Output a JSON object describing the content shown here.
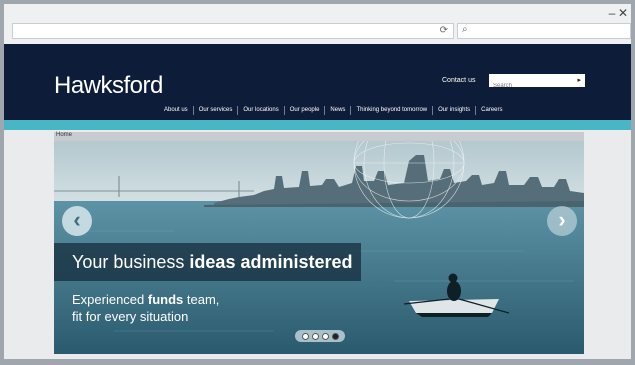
{
  "browser": {
    "window_controls": {
      "minimize": "–",
      "close": "✕"
    },
    "address": {
      "value": "",
      "refresh_icon": "⟳"
    },
    "search": {
      "value": "",
      "icon": "⌕"
    }
  },
  "site": {
    "logo": "Hawksford",
    "contact_label": "Contact us",
    "search_placeholder": "Search",
    "search_go": "▸",
    "nav": [
      "About us",
      "Our services",
      "Our locations",
      "Our people",
      "News",
      "Thinking beyond tomorrow",
      "Our insights",
      "Careers"
    ],
    "breadcrumb": "Home",
    "hero": {
      "headline_light": "Your business ",
      "headline_bold": "ideas administered",
      "sub_line1_light": "Experienced ",
      "sub_line1_bold": "funds",
      "sub_line1_rest": " team,",
      "sub_line2": "fit for every situation",
      "prev_arrow": "‹",
      "next_arrow": "›",
      "slides": 4,
      "active_slide": 4
    },
    "colors": {
      "header": "#0d1c38",
      "band": "#49b6c6",
      "accent_bar": "#c8ccd1"
    }
  }
}
